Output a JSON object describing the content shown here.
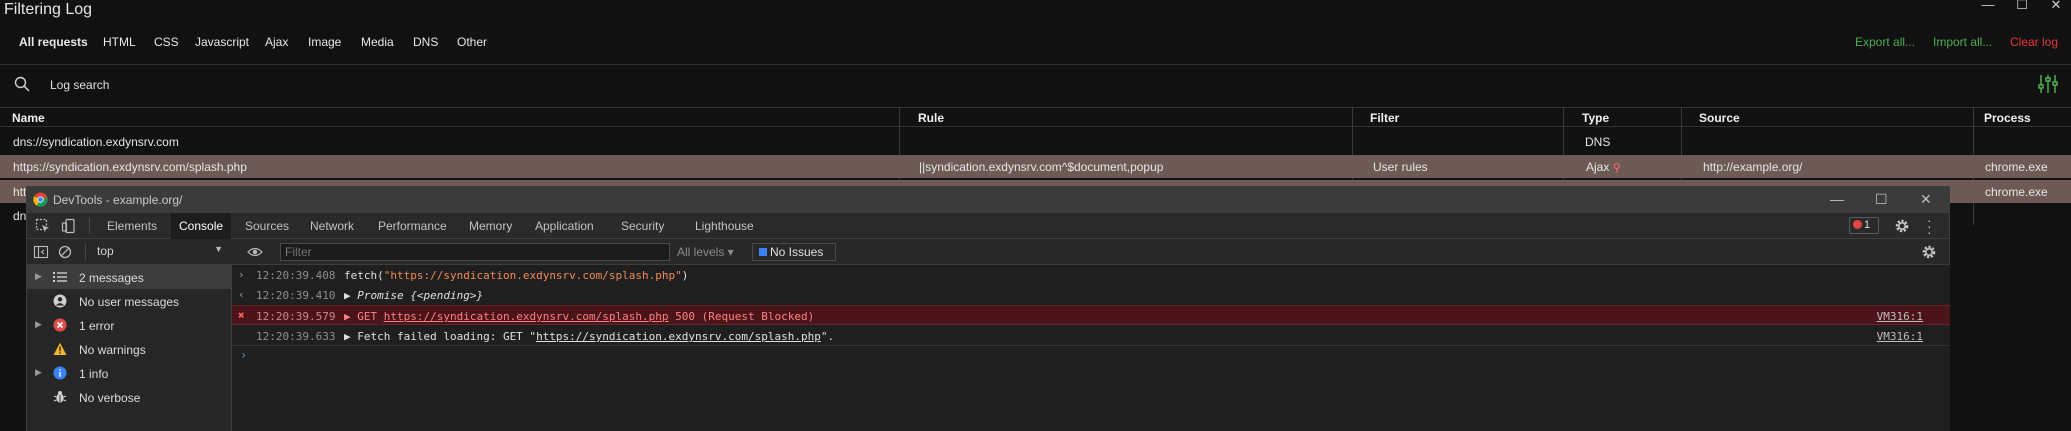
{
  "app": {
    "title": "Filtering Log",
    "window_controls": {
      "minimize": "—",
      "maximize": "☐",
      "close": "✕"
    }
  },
  "filter_tabs": [
    "All requests",
    "HTML",
    "CSS",
    "Javascript",
    "Ajax",
    "Image",
    "Media",
    "DNS",
    "Other"
  ],
  "actions": {
    "export": "Export all...",
    "import": "Import all...",
    "clear": "Clear log",
    "export_color": "#4caf50",
    "import_color": "#4caf50",
    "clear_color": "#e53935"
  },
  "search": {
    "label": "Log search",
    "icon": "search-icon"
  },
  "columns": {
    "name": "Name",
    "rule": "Rule",
    "filter": "Filter",
    "type": "Type",
    "source": "Source",
    "process": "Process"
  },
  "rows": [
    {
      "name": "dns://syndication.exdynsrv.com",
      "rule": "",
      "filter": "",
      "type": "DNS",
      "source": "",
      "process": ""
    },
    {
      "name": "https://syndication.exdynsrv.com/splash.php",
      "rule": "||syndication.exdynsrv.com^$document,popup",
      "filter": "User rules",
      "type": "Ajax",
      "source": "http://example.org/",
      "process": "chrome.exe"
    },
    {
      "name": "htt",
      "rule": "",
      "filter": "",
      "type": "",
      "source": "",
      "process": "chrome.exe"
    },
    {
      "name": "dn",
      "rule": "",
      "filter": "",
      "type": "",
      "source": "",
      "process": ""
    }
  ],
  "devtools": {
    "title": "DevTools - example.org/",
    "tabs": [
      "Elements",
      "Console",
      "Sources",
      "Network",
      "Performance",
      "Memory",
      "Application",
      "Security",
      "Lighthouse"
    ],
    "active_tab": "Console",
    "error_count": "1",
    "context": "top",
    "filter_placeholder": "Filter",
    "levels": "All levels ▾",
    "issues": "No Issues",
    "sidebar": [
      {
        "label": "2 messages",
        "icon": "list-icon",
        "expandable": true
      },
      {
        "label": "No user messages",
        "icon": "user-icon",
        "expandable": false
      },
      {
        "label": "1 error",
        "icon": "error-icon",
        "expandable": true
      },
      {
        "label": "No warnings",
        "icon": "warning-icon",
        "expandable": false
      },
      {
        "label": "1 info",
        "icon": "info-icon",
        "expandable": true
      },
      {
        "label": "No verbose",
        "icon": "bug-icon",
        "expandable": false
      }
    ],
    "console_lines": [
      {
        "gutter": "›",
        "ts": "12:20:39.408",
        "pre": "fetch(",
        "str": "\"https://syndication.exdynsrv.com/splash.php\"",
        "post": ")",
        "src": ""
      },
      {
        "gutter": "‹",
        "ts": "12:20:39.410",
        "pre": "▶ Promise {<pending>}",
        "str": "",
        "post": "",
        "src": ""
      },
      {
        "gutter": "✖",
        "ts": "12:20:39.579",
        "pre": "▶ GET ",
        "link": "https://syndication.exdynsrv.com/splash.php",
        "post": " 500 (Request Blocked)",
        "src": "VM316:1"
      },
      {
        "gutter": "",
        "ts": "12:20:39.633",
        "pre": "▶ Fetch failed loading: GET \"",
        "link": "https://syndication.exdynsrv.com/splash.php",
        "post": "\".",
        "src": "VM316:1"
      }
    ],
    "prompt": "›"
  }
}
